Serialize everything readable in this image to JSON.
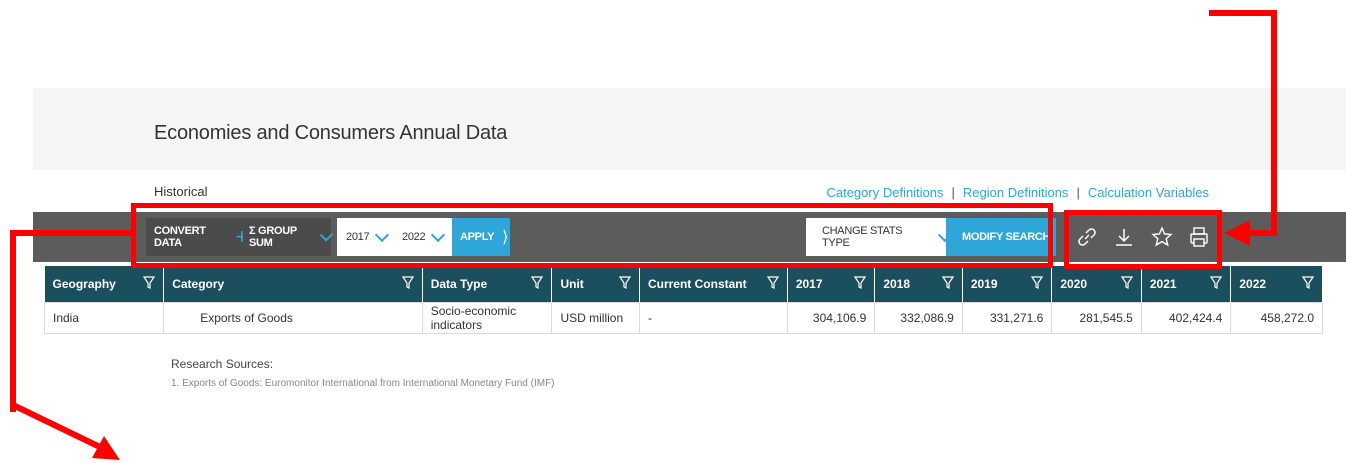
{
  "page": {
    "title": "Economies and Consumers Annual Data",
    "subhead": "Historical",
    "links": [
      "Category Definitions",
      "Region Definitions",
      "Calculation Variables"
    ]
  },
  "toolbar": {
    "convert_data": "CONVERT DATA",
    "group_sum": "Σ GROUP SUM",
    "year_from": "2017",
    "year_to": "2022",
    "apply": "APPLY",
    "change_stats": "CHANGE STATS TYPE",
    "modify_search": "MODIFY SEARCH",
    "icons": [
      "link-icon",
      "download-icon",
      "star-icon",
      "print-icon"
    ]
  },
  "table": {
    "columns": [
      "Geography",
      "Category",
      "Data Type",
      "Unit",
      "Current Constant",
      "2017",
      "2018",
      "2019",
      "2020",
      "2021",
      "2022"
    ],
    "rows": [
      {
        "geography": "India",
        "category": "Exports of Goods",
        "data_type": "Socio-economic indicators",
        "unit": "USD million",
        "current_constant": "-",
        "y2017": "304,106.9",
        "y2018": "332,086.9",
        "y2019": "331,271.6",
        "y2020": "281,545.5",
        "y2021": "402,424.4",
        "y2022": "458,272.0"
      }
    ]
  },
  "research": {
    "label": "Research Sources:",
    "items": [
      "1. Exports of Goods: Euromonitor International from International Monetary Fund (IMF)"
    ]
  },
  "colors": {
    "header_bg": "#1c4f5e",
    "toolbar_bg": "#5c5c5c",
    "accent": "#2ea6d8",
    "annotation": "#ff0000"
  }
}
